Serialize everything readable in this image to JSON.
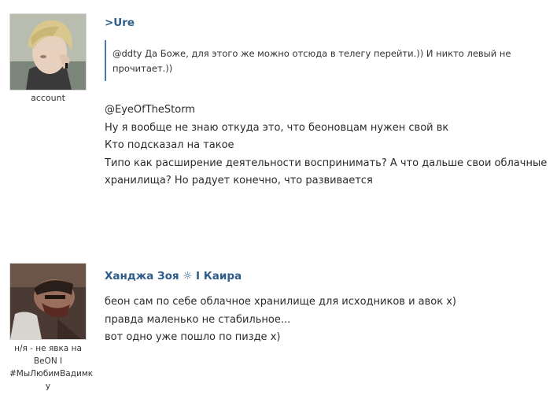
{
  "post1": {
    "username": ">Ure",
    "avatar_caption": "account",
    "quote": "@ddty Да Боже, для этого же можно отсюда в телегу перейти.)) И никто левый не прочитает.))",
    "message_lines": [
      "@EyeOfTheStorm",
      "Ну я вообще не знаю откуда это, что беоновцам нужен свой вк",
      "Кто подсказал на такое",
      "Типо как расширение деятельности воспринимать? А что дальше свои облачные",
      "хранилища? Но радует конечно, что развивается"
    ]
  },
  "post2": {
    "username": "Ханджа Зоя ☼ I Каира",
    "avatar_caption": "н/я - не явка на\nBeON I\n#МыЛюбимВадимк\nу",
    "message_lines": [
      "беон сам по себе облачное хранилище для исходников и авок х)",
      "правда маленько не стабильное...",
      "вот одно уже пошло по пизде х)"
    ]
  },
  "colors": {
    "username": "#2e5d8c",
    "quote_border": "#4a7ab0"
  }
}
